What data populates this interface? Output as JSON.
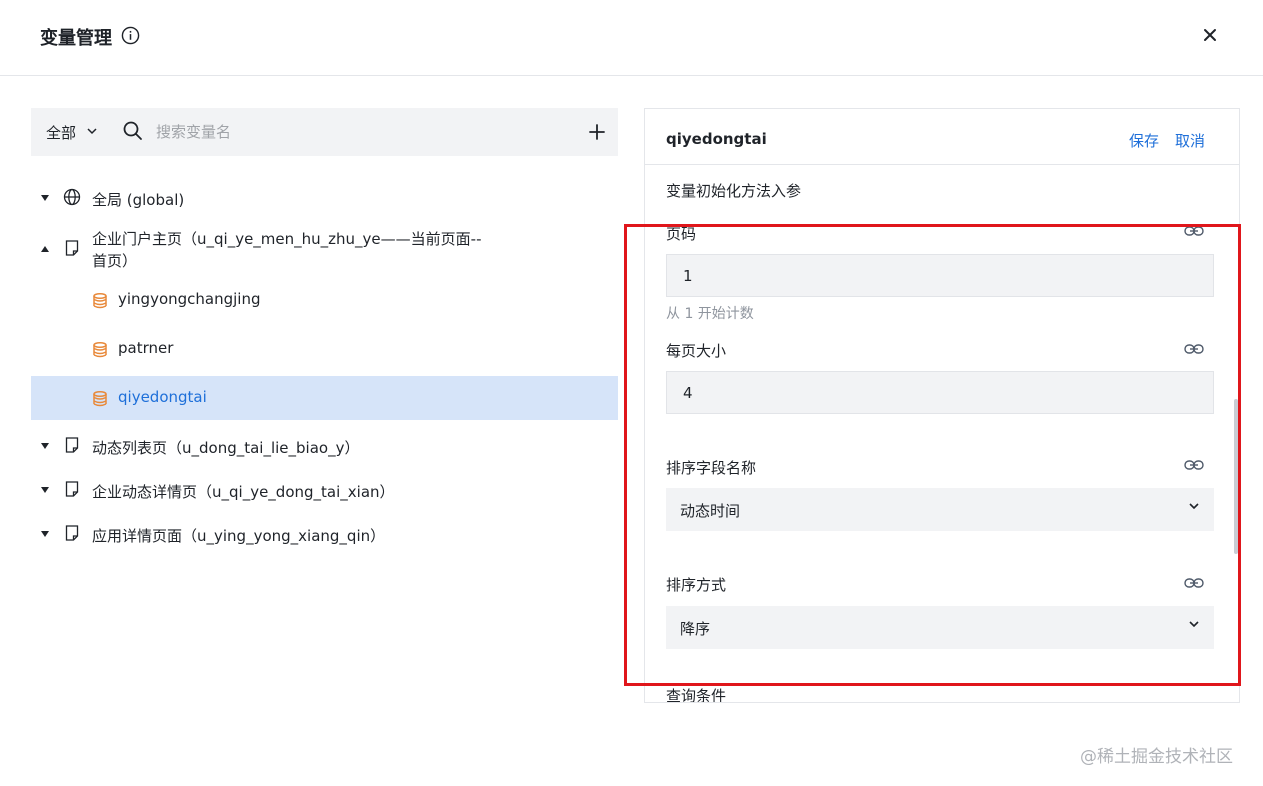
{
  "dialog": {
    "title": "变量管理",
    "close_label": "×"
  },
  "toolbar": {
    "scope": "全部",
    "search_placeholder": "搜索变量名"
  },
  "tree": {
    "global": "全局 (global)",
    "home_line1": "企业门户主页（u_qi_ye_men_hu_zhu_ye——当前页面--",
    "home_line2": "首页）",
    "vars": [
      "yingyongchangjing",
      "patrner",
      "qiyedongtai"
    ],
    "pages": [
      "动态列表页（u_dong_tai_lie_biao_y）",
      "企业动态详情页（u_qi_ye_dong_tai_xian）",
      "应用详情页面（u_ying_yong_xiang_qin）"
    ]
  },
  "detail": {
    "name": "qiyedongtai",
    "save": "保存",
    "cancel": "取消",
    "section": "变量初始化方法入参",
    "page_label": "页码",
    "page_value": "1",
    "page_hint": "从 1 开始计数",
    "size_label": "每页大小",
    "size_value": "4",
    "sort_field_label": "排序字段名称",
    "sort_field_value": "动态时间",
    "sort_order_label": "排序方式",
    "sort_order_value": "降序",
    "cut_label": "查询条件"
  },
  "watermark": "@稀土掘金技术社区",
  "colors": {
    "accent": "#1e6fd9",
    "selected_bg": "#d6e4f9",
    "highlight": "#e0161b",
    "db_icon": "#e8893a"
  }
}
